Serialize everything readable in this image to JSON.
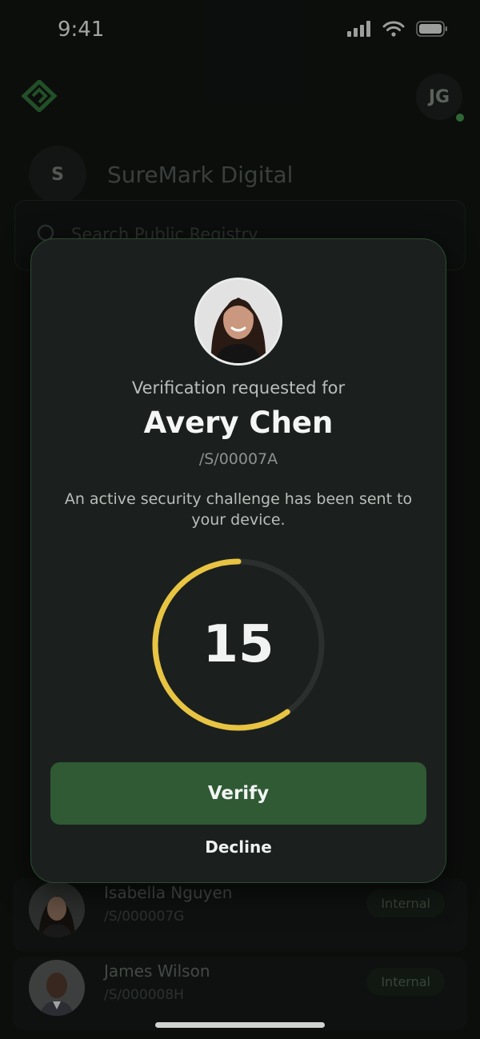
{
  "status_bar": {
    "time": "9:41"
  },
  "header": {
    "user_initials": "JG"
  },
  "org": {
    "initial": "S",
    "name": "SureMark Digital"
  },
  "search": {
    "placeholder": "Search Public Registry"
  },
  "list": [
    {
      "name": "Isabella Nguyen",
      "id": "/S/000007G",
      "tag": "Internal"
    },
    {
      "name": "James Wilson",
      "id": "/S/000008H",
      "tag": "Internal"
    }
  ],
  "modal": {
    "requested_label": "Verification requested for",
    "person_name": "Avery Chen",
    "person_id": "/S/00007A",
    "description": "An active security challenge has been sent to your device.",
    "countdown": "15",
    "countdown_progress": 0.6,
    "verify_label": "Verify",
    "decline_label": "Decline"
  },
  "colors": {
    "accent_green": "#2f5a34",
    "timer_yellow": "#e8c443",
    "background": "#101311"
  }
}
